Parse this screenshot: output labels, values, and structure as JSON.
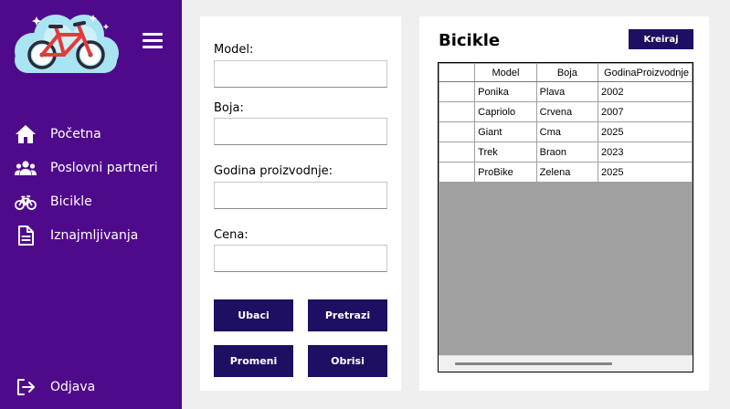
{
  "sidebar": {
    "menu_icon": "hamburger-icon",
    "logo_icon": "bicycle-logo",
    "items": [
      {
        "label": "Početna",
        "icon": "home-icon"
      },
      {
        "label": "Poslovni partneri",
        "icon": "users-icon"
      },
      {
        "label": "Bicikle",
        "icon": "bicycle-icon"
      },
      {
        "label": "Iznajmljivanja",
        "icon": "document-icon"
      }
    ],
    "logout": {
      "label": "Odjava",
      "icon": "logout-icon"
    }
  },
  "form": {
    "fields": [
      {
        "label": "Model:",
        "value": ""
      },
      {
        "label": "Boja:",
        "value": ""
      },
      {
        "label": "Godina proizvodnje:",
        "value": ""
      },
      {
        "label": "Cena:",
        "value": ""
      }
    ],
    "buttons": {
      "insert": "Ubaci",
      "search": "Pretrazi",
      "update": "Promeni",
      "delete": "Obrisi"
    }
  },
  "list": {
    "title": "Bicikle",
    "create_label": "Kreiraj",
    "columns": [
      "Model",
      "Boja",
      "GodinaProizvodnje"
    ],
    "rows": [
      [
        "Ponika",
        "Plava",
        "2002"
      ],
      [
        "Capriolo",
        "Crvena",
        "2007"
      ],
      [
        "Giant",
        "Cma",
        "2025"
      ],
      [
        "Trek",
        "Braon",
        "2023"
      ],
      [
        "ProBike",
        "Zelena",
        "2025"
      ]
    ]
  },
  "colors": {
    "sidebar_bg": "#4f0a8c",
    "button_bg": "#1f0f63",
    "page_bg": "#efefef",
    "grid_empty_bg": "#a0a0a0"
  }
}
